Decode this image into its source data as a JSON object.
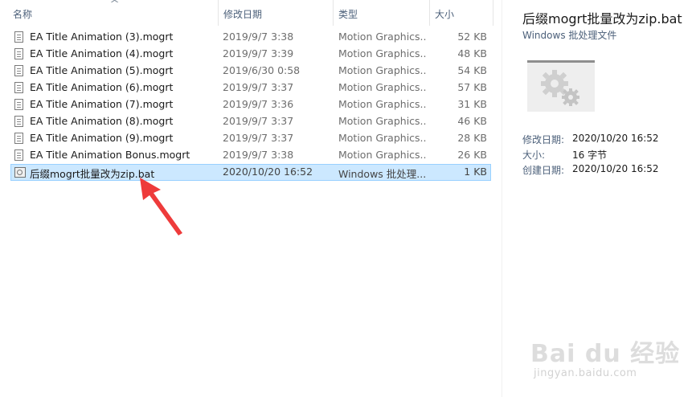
{
  "columns": {
    "name": "名称",
    "date": "修改日期",
    "type": "类型",
    "size": "大小"
  },
  "files": [
    {
      "name": "EA Title Animation (3).mogrt",
      "date": "2019/9/7 3:38",
      "type": "Motion Graphics...",
      "size": "52 KB",
      "icon": "document-icon"
    },
    {
      "name": "EA Title Animation (4).mogrt",
      "date": "2019/9/7 3:39",
      "type": "Motion Graphics...",
      "size": "48 KB",
      "icon": "document-icon"
    },
    {
      "name": "EA Title Animation (5).mogrt",
      "date": "2019/6/30 0:58",
      "type": "Motion Graphics...",
      "size": "54 KB",
      "icon": "document-icon"
    },
    {
      "name": "EA Title Animation (6).mogrt",
      "date": "2019/9/7 3:37",
      "type": "Motion Graphics...",
      "size": "57 KB",
      "icon": "document-icon"
    },
    {
      "name": "EA Title Animation (7).mogrt",
      "date": "2019/9/7 3:36",
      "type": "Motion Graphics...",
      "size": "31 KB",
      "icon": "document-icon"
    },
    {
      "name": "EA Title Animation (8).mogrt",
      "date": "2019/9/7 3:37",
      "type": "Motion Graphics...",
      "size": "46 KB",
      "icon": "document-icon"
    },
    {
      "name": "EA Title Animation (9).mogrt",
      "date": "2019/9/7 3:37",
      "type": "Motion Graphics...",
      "size": "28 KB",
      "icon": "document-icon"
    },
    {
      "name": "EA Title Animation Bonus.mogrt",
      "date": "2019/9/7 3:38",
      "type": "Motion Graphics...",
      "size": "26 KB",
      "icon": "document-icon"
    },
    {
      "name": "后缀mogrt批量改为zip.bat",
      "date": "2020/10/20 16:52",
      "type": "Windows 批处理...",
      "size": "1 KB",
      "icon": "batch-file-icon",
      "selected": true
    }
  ],
  "details": {
    "title": "后缀mogrt批量改为zip.bat",
    "subtitle": "Windows 批处理文件",
    "thumbnail_icon": "gears-icon",
    "props": [
      {
        "label": "修改日期:",
        "value": "2020/10/20 16:52"
      },
      {
        "label": "大小:",
        "value": "16 字节"
      },
      {
        "label": "创建日期:",
        "value": "2020/10/20 16:52"
      }
    ]
  },
  "watermark": {
    "main": "Bai du 经验",
    "sub": "jingyan.baidu.com"
  },
  "colors": {
    "selection_bg": "#cce8ff",
    "selection_border": "#99d1ff",
    "header_text": "#4c607a",
    "annotation_arrow": "#ee3b3b"
  }
}
